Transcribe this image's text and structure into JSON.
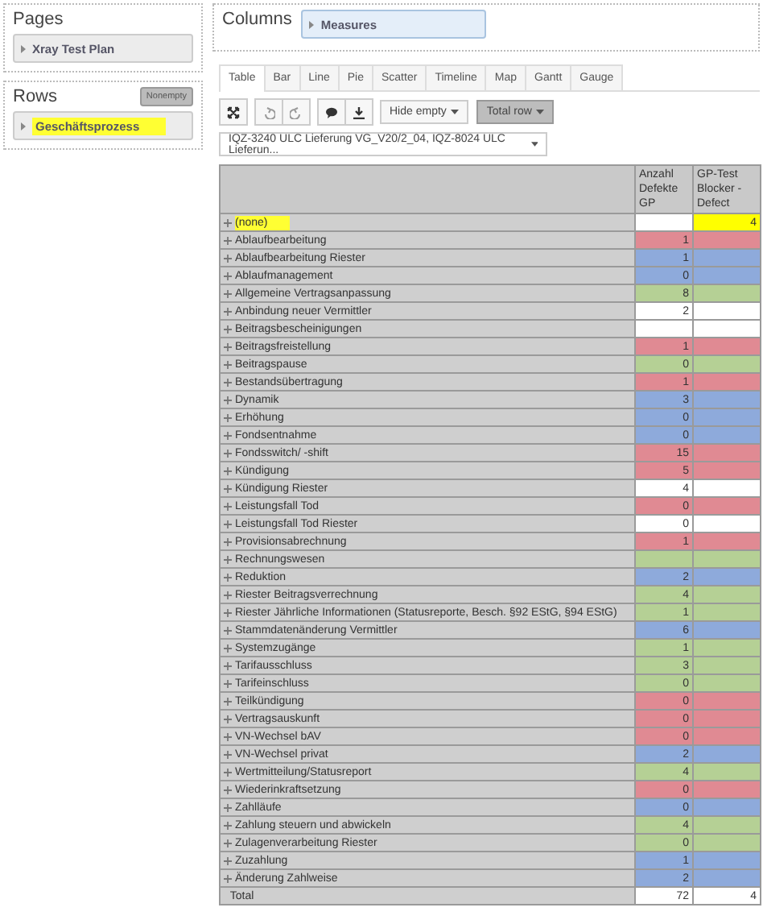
{
  "pages": {
    "title": "Pages",
    "items": [
      "Xray Test Plan"
    ]
  },
  "rows_panel": {
    "title": "Rows",
    "button": "Nonempty",
    "items": [
      {
        "label": "Geschäftsprozess",
        "highlighted": true
      }
    ]
  },
  "columns_panel": {
    "title": "Columns",
    "items": [
      "Measures"
    ]
  },
  "tabs": [
    {
      "label": "Table",
      "selected": true
    },
    {
      "label": "Bar",
      "selected": false
    },
    {
      "label": "Line",
      "selected": false
    },
    {
      "label": "Pie",
      "selected": false
    },
    {
      "label": "Scatter",
      "selected": false
    },
    {
      "label": "Timeline",
      "selected": false
    },
    {
      "label": "Map",
      "selected": false
    },
    {
      "label": "Gantt",
      "selected": false
    },
    {
      "label": "Gauge",
      "selected": false
    }
  ],
  "toolbar": {
    "dropdowns": [
      {
        "label": "Hide empty",
        "pressed": false
      },
      {
        "label": "Total row",
        "pressed": true
      }
    ]
  },
  "filter": {
    "value": "IQZ-3240 ULC Lieferung VG_V20/2_04, IQZ-8024 ULC Lieferun..."
  },
  "table": {
    "columns": [
      "Anzahl Defekte GP",
      "GP-Test Blocker - Defect"
    ],
    "rows": [
      {
        "label": "(none)",
        "highlighted": true,
        "cells": [
          {
            "color": "#ffffff"
          },
          {
            "value": "4",
            "color": "#ffff00"
          }
        ]
      },
      {
        "label": "Ablaufbearbeitung",
        "highlighted": false,
        "cells": [
          {
            "value": "1",
            "color": "#e08a93"
          },
          {
            "color": "#e08a93"
          }
        ]
      },
      {
        "label": "Ablaufbearbeitung Riester",
        "highlighted": false,
        "cells": [
          {
            "value": "1",
            "color": "#8eaadb"
          },
          {
            "color": "#8eaadb"
          }
        ]
      },
      {
        "label": "Ablaufmanagement",
        "highlighted": false,
        "cells": [
          {
            "value": "0",
            "color": "#8eaadb"
          },
          {
            "color": "#8eaadb"
          }
        ]
      },
      {
        "label": "Allgemeine Vertragsanpassung",
        "highlighted": false,
        "cells": [
          {
            "value": "8",
            "color": "#b5d095"
          },
          {
            "color": "#b5d095"
          }
        ]
      },
      {
        "label": "Anbindung neuer Vermittler",
        "highlighted": false,
        "cells": [
          {
            "value": "2",
            "color": "#ffffff"
          },
          {
            "color": "#ffffff"
          }
        ]
      },
      {
        "label": "Beitragsbescheinigungen",
        "highlighted": false,
        "cells": [
          {
            "color": "#ffffff"
          },
          {
            "color": "#ffffff"
          }
        ]
      },
      {
        "label": "Beitragsfreistellung",
        "highlighted": false,
        "cells": [
          {
            "value": "1",
            "color": "#e08a93"
          },
          {
            "color": "#e08a93"
          }
        ]
      },
      {
        "label": "Beitragspause",
        "highlighted": false,
        "cells": [
          {
            "value": "0",
            "color": "#b5d095"
          },
          {
            "color": "#b5d095"
          }
        ]
      },
      {
        "label": "Bestandsübertragung",
        "highlighted": false,
        "cells": [
          {
            "value": "1",
            "color": "#e08a93"
          },
          {
            "color": "#e08a93"
          }
        ]
      },
      {
        "label": "Dynamik",
        "highlighted": false,
        "cells": [
          {
            "value": "3",
            "color": "#8eaadb"
          },
          {
            "color": "#8eaadb"
          }
        ]
      },
      {
        "label": "Erhöhung",
        "highlighted": false,
        "cells": [
          {
            "value": "0",
            "color": "#8eaadb"
          },
          {
            "color": "#8eaadb"
          }
        ]
      },
      {
        "label": "Fondsentnahme",
        "highlighted": false,
        "cells": [
          {
            "value": "0",
            "color": "#8eaadb"
          },
          {
            "color": "#8eaadb"
          }
        ]
      },
      {
        "label": "Fondsswitch/ -shift",
        "highlighted": false,
        "cells": [
          {
            "value": "15",
            "color": "#e08a93"
          },
          {
            "color": "#e08a93"
          }
        ]
      },
      {
        "label": "Kündigung",
        "highlighted": false,
        "cells": [
          {
            "value": "5",
            "color": "#e08a93"
          },
          {
            "color": "#e08a93"
          }
        ]
      },
      {
        "label": "Kündigung Riester",
        "highlighted": false,
        "cells": [
          {
            "value": "4",
            "color": "#ffffff"
          },
          {
            "color": "#ffffff"
          }
        ]
      },
      {
        "label": "Leistungsfall Tod",
        "highlighted": false,
        "cells": [
          {
            "value": "0",
            "color": "#e08a93"
          },
          {
            "color": "#e08a93"
          }
        ]
      },
      {
        "label": "Leistungsfall Tod Riester",
        "highlighted": false,
        "cells": [
          {
            "value": "0",
            "color": "#ffffff"
          },
          {
            "color": "#ffffff"
          }
        ]
      },
      {
        "label": "Provisionsabrechnung",
        "highlighted": false,
        "cells": [
          {
            "value": "1",
            "color": "#e08a93"
          },
          {
            "color": "#e08a93"
          }
        ]
      },
      {
        "label": "Rechnungswesen",
        "highlighted": false,
        "cells": [
          {
            "color": "#b5d095"
          },
          {
            "color": "#b5d095"
          }
        ]
      },
      {
        "label": "Reduktion",
        "highlighted": false,
        "cells": [
          {
            "value": "2",
            "color": "#8eaadb"
          },
          {
            "color": "#8eaadb"
          }
        ]
      },
      {
        "label": "Riester Beitragsverrechnung",
        "highlighted": false,
        "cells": [
          {
            "value": "4",
            "color": "#b5d095"
          },
          {
            "color": "#b5d095"
          }
        ]
      },
      {
        "label": "Riester Jährliche Informationen (Statusreporte, Besch. §92 EStG, §94 EStG)",
        "highlighted": false,
        "cells": [
          {
            "value": "1",
            "color": "#b5d095"
          },
          {
            "color": "#b5d095"
          }
        ]
      },
      {
        "label": "Stammdatenänderung Vermittler",
        "highlighted": false,
        "cells": [
          {
            "value": "6",
            "color": "#8eaadb"
          },
          {
            "color": "#8eaadb"
          }
        ]
      },
      {
        "label": "Systemzugänge",
        "highlighted": false,
        "cells": [
          {
            "value": "1",
            "color": "#b5d095"
          },
          {
            "color": "#b5d095"
          }
        ]
      },
      {
        "label": "Tarifausschluss",
        "highlighted": false,
        "cells": [
          {
            "value": "3",
            "color": "#b5d095"
          },
          {
            "color": "#b5d095"
          }
        ]
      },
      {
        "label": "Tarifeinschluss",
        "highlighted": false,
        "cells": [
          {
            "value": "0",
            "color": "#b5d095"
          },
          {
            "color": "#b5d095"
          }
        ]
      },
      {
        "label": "Teilkündigung",
        "highlighted": false,
        "cells": [
          {
            "value": "0",
            "color": "#e08a93"
          },
          {
            "color": "#e08a93"
          }
        ]
      },
      {
        "label": "Vertragsauskunft",
        "highlighted": false,
        "cells": [
          {
            "value": "0",
            "color": "#e08a93"
          },
          {
            "color": "#e08a93"
          }
        ]
      },
      {
        "label": "VN-Wechsel bAV",
        "highlighted": false,
        "cells": [
          {
            "value": "0",
            "color": "#e08a93"
          },
          {
            "color": "#e08a93"
          }
        ]
      },
      {
        "label": "VN-Wechsel privat",
        "highlighted": false,
        "cells": [
          {
            "value": "2",
            "color": "#8eaadb"
          },
          {
            "color": "#8eaadb"
          }
        ]
      },
      {
        "label": "Wertmitteilung/Statusreport",
        "highlighted": false,
        "cells": [
          {
            "value": "4",
            "color": "#b5d095"
          },
          {
            "color": "#b5d095"
          }
        ]
      },
      {
        "label": "Wiederinkraftsetzung",
        "highlighted": false,
        "cells": [
          {
            "value": "0",
            "color": "#e08a93"
          },
          {
            "color": "#e08a93"
          }
        ]
      },
      {
        "label": "Zahlläufe",
        "highlighted": false,
        "cells": [
          {
            "value": "0",
            "color": "#8eaadb"
          },
          {
            "color": "#8eaadb"
          }
        ]
      },
      {
        "label": "Zahlung steuern und abwickeln",
        "highlighted": false,
        "cells": [
          {
            "value": "4",
            "color": "#b5d095"
          },
          {
            "color": "#b5d095"
          }
        ]
      },
      {
        "label": "Zulagenverarbeitung Riester",
        "highlighted": false,
        "cells": [
          {
            "value": "0",
            "color": "#b5d095"
          },
          {
            "color": "#b5d095"
          }
        ]
      },
      {
        "label": "Zuzahlung",
        "highlighted": false,
        "cells": [
          {
            "value": "1",
            "color": "#8eaadb"
          },
          {
            "color": "#8eaadb"
          }
        ]
      },
      {
        "label": "Änderung Zahlweise",
        "highlighted": false,
        "cells": [
          {
            "value": "2",
            "color": "#8eaadb"
          },
          {
            "color": "#8eaadb"
          }
        ]
      }
    ],
    "total": {
      "label": "Total",
      "cells": [
        "72",
        "4"
      ]
    }
  }
}
